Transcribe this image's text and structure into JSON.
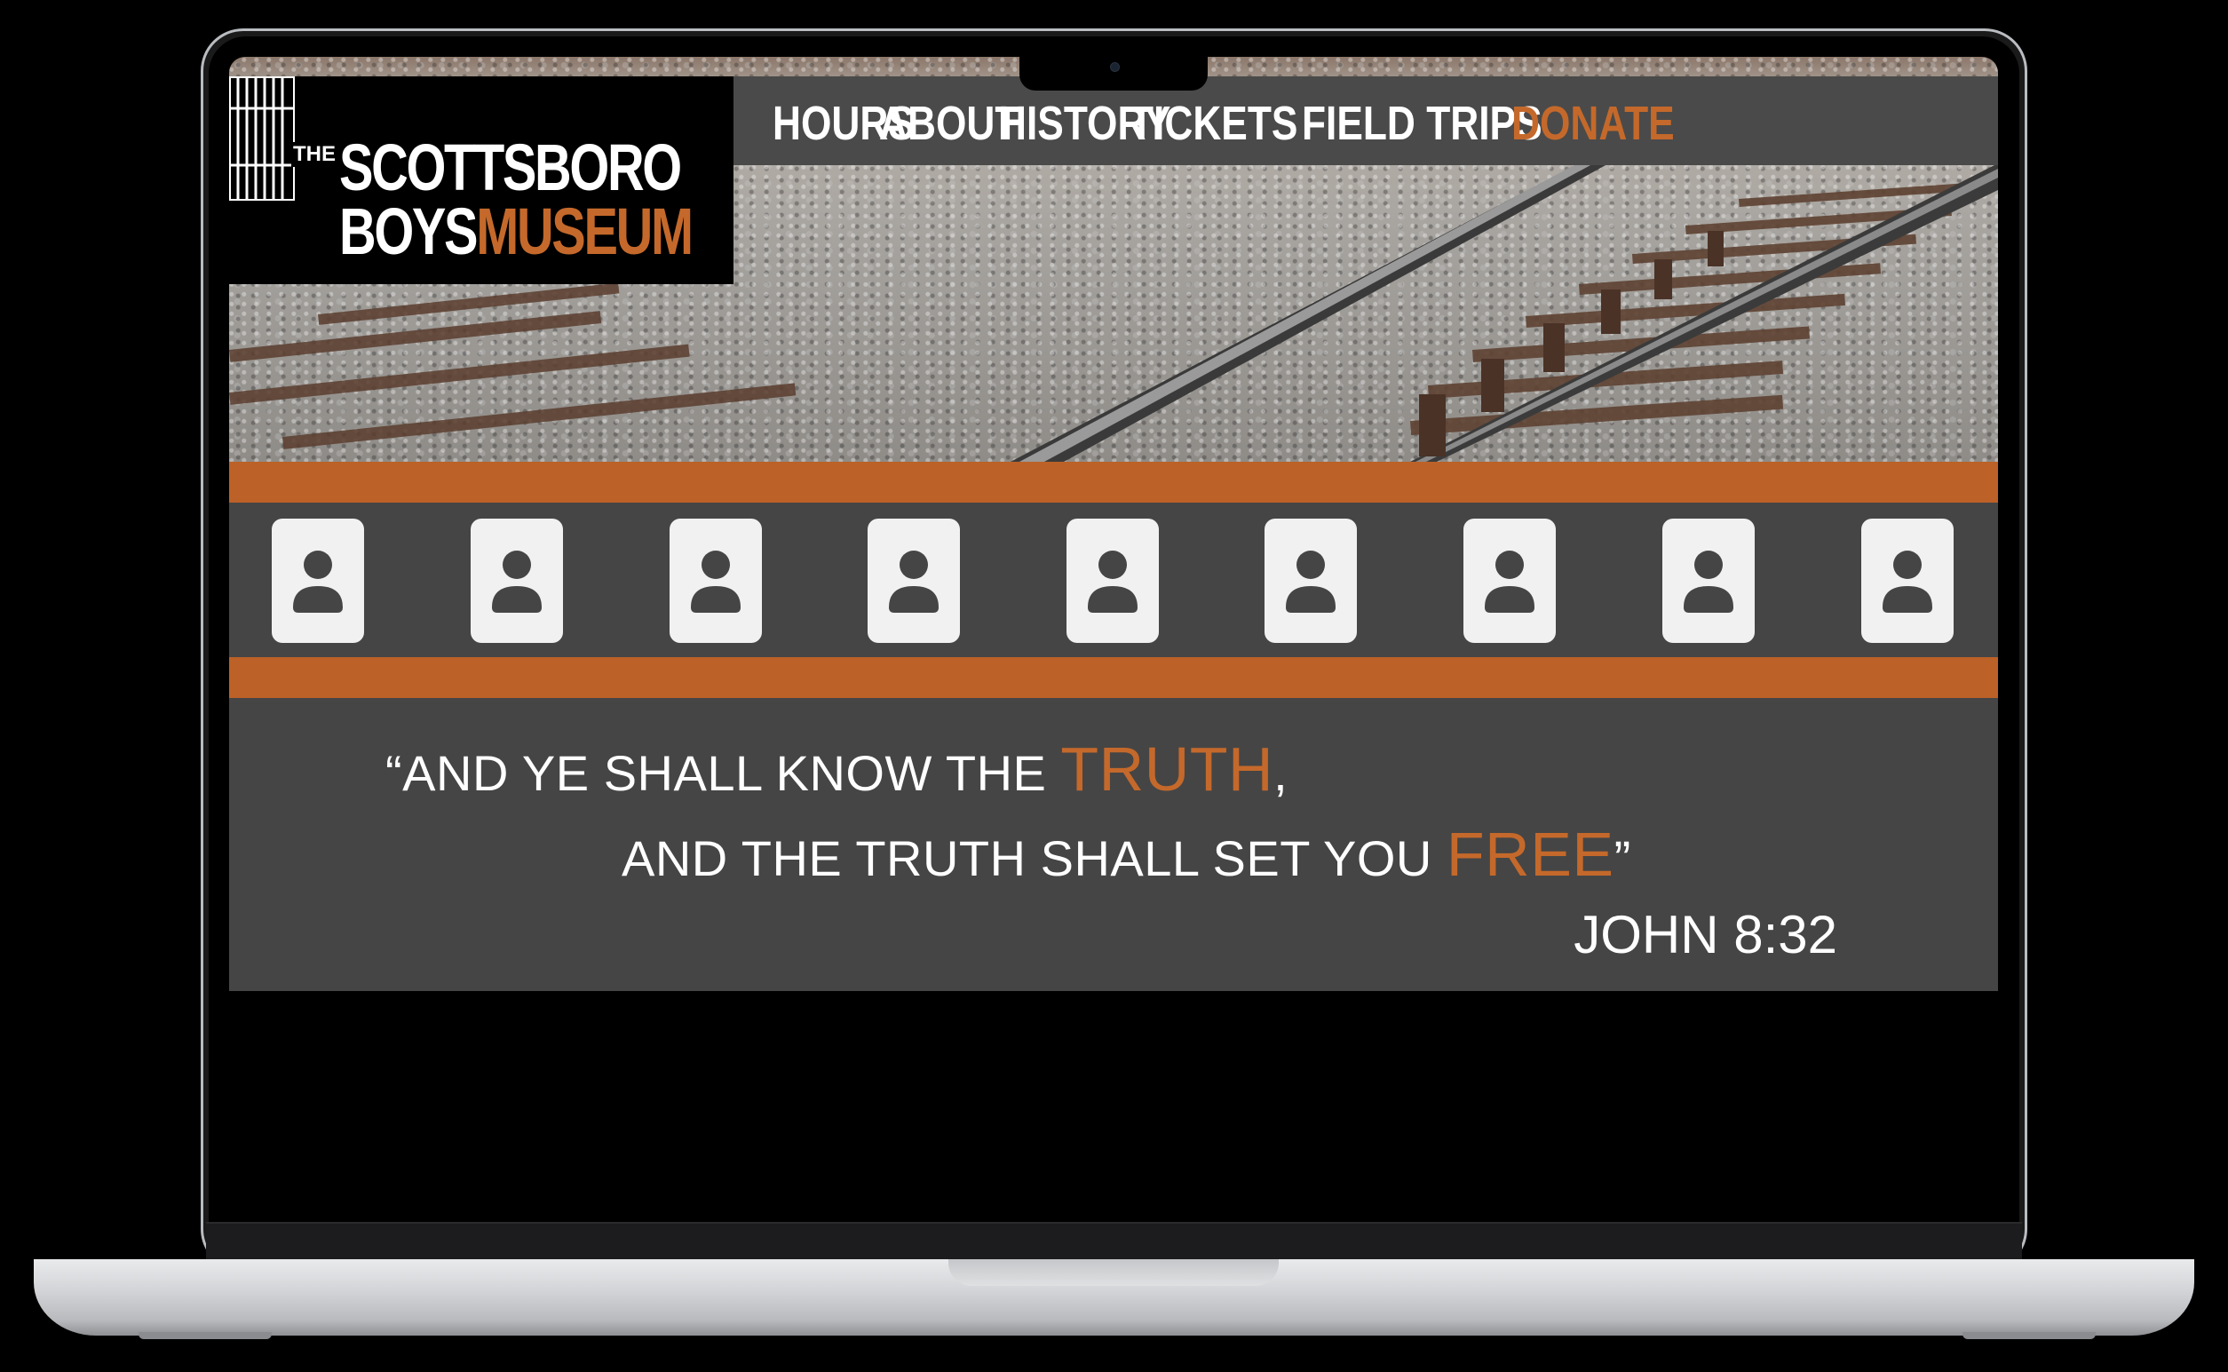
{
  "site": {
    "logo": {
      "the": "THE",
      "line1": "SCOTTSBORO",
      "line2_a": "BOYS",
      "line2_b": "MUSEUM"
    },
    "nav": [
      {
        "label": "HOURS"
      },
      {
        "label": "ABOUT"
      },
      {
        "label": "HISTORY"
      },
      {
        "label": "TICKETS"
      },
      {
        "label": "FIELD TRIPS"
      },
      {
        "label": "DONATE"
      }
    ],
    "portraits": [
      "person-icon",
      "person-icon",
      "person-icon",
      "person-icon",
      "person-icon",
      "person-icon",
      "person-icon",
      "person-icon",
      "person-icon"
    ],
    "quote": {
      "line1_a": "“AND YE SHALL KNOW THE ",
      "line1_hl": "TRUTH",
      "line1_b": ",",
      "line2_a": "AND THE TRUTH SHALL SET YOU ",
      "line2_hl": "FREE",
      "line2_b": "”",
      "reference": "JOHN 8:32"
    }
  },
  "colors": {
    "accent": "#c4692b",
    "stripe": "#bc6127",
    "band": "#454545",
    "nav_bg": "#4a4a4a"
  }
}
